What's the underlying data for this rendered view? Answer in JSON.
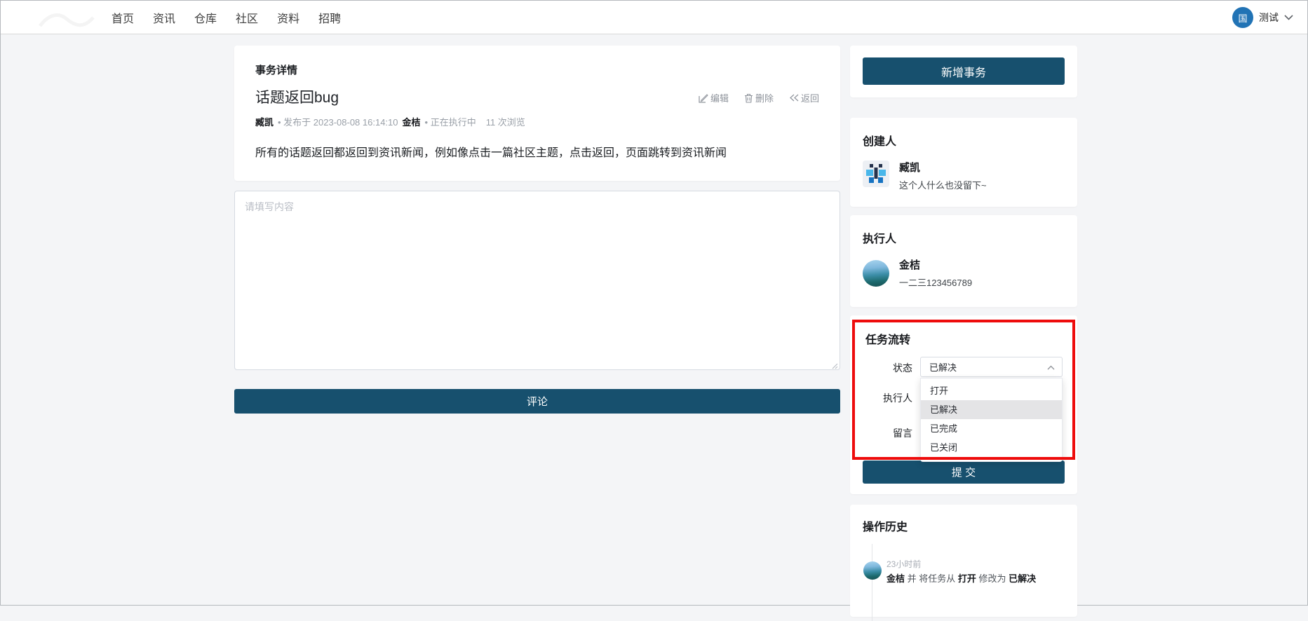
{
  "header": {
    "nav_items": [
      "首页",
      "资讯",
      "仓库",
      "社区",
      "资料",
      "招聘"
    ],
    "user": {
      "avatar_text": "国",
      "name": "测试"
    }
  },
  "task_detail": {
    "section_title": "事务详情",
    "title": "话题返回bug",
    "actions": {
      "edit": "编辑",
      "delete": "删除",
      "back": "返回"
    },
    "meta": {
      "author": "臧凯",
      "published": "• 发布于 2023-08-08 16:14:10",
      "executor": "金桔",
      "status": "• 正在执行中",
      "views": "11 次浏览"
    },
    "description": "所有的话题返回都返回到资讯新闻，例如像点击一篇社区主题，点击返回，页面跳转到资讯新闻"
  },
  "comment": {
    "placeholder": "请填写内容",
    "submit_label": "评论"
  },
  "sidebar": {
    "new_task_label": "新增事务",
    "creator": {
      "heading": "创建人",
      "name": "臧凯",
      "bio": "这个人什么也没留下~"
    },
    "executor": {
      "heading": "执行人",
      "name": "金桔",
      "bio": "一二三123456789"
    },
    "workflow": {
      "heading": "任务流转",
      "status_label": "状态",
      "status_value": "已解决",
      "executor_label": "执行人",
      "message_label": "留言",
      "dropdown_options": [
        "打开",
        "已解决",
        "已完成",
        "已关闭"
      ],
      "selected_option": "已解决",
      "submit_label": "提 交"
    },
    "history": {
      "heading": "操作历史",
      "items": [
        {
          "time": "23小时前",
          "parts": [
            {
              "t": "金桔",
              "b": true
            },
            {
              "t": " 并 将任务从 ",
              "b": false
            },
            {
              "t": "打开",
              "b": true
            },
            {
              "t": " 修改为 ",
              "b": false
            },
            {
              "t": "已解决",
              "b": true
            }
          ]
        }
      ]
    }
  },
  "colors": {
    "accent_teal": "#17506e",
    "annotation_red": "#ee0c0c",
    "avatar_blue": "#2173b5",
    "selected_option_bg": "#e4e4e6",
    "page_bg": "#f4f5f7"
  },
  "icons": {
    "edit": "edit-icon",
    "delete": "trash-icon",
    "back": "rewind-icon",
    "user_menu": "chevron-down-icon",
    "select_open": "chevron-up-icon"
  }
}
